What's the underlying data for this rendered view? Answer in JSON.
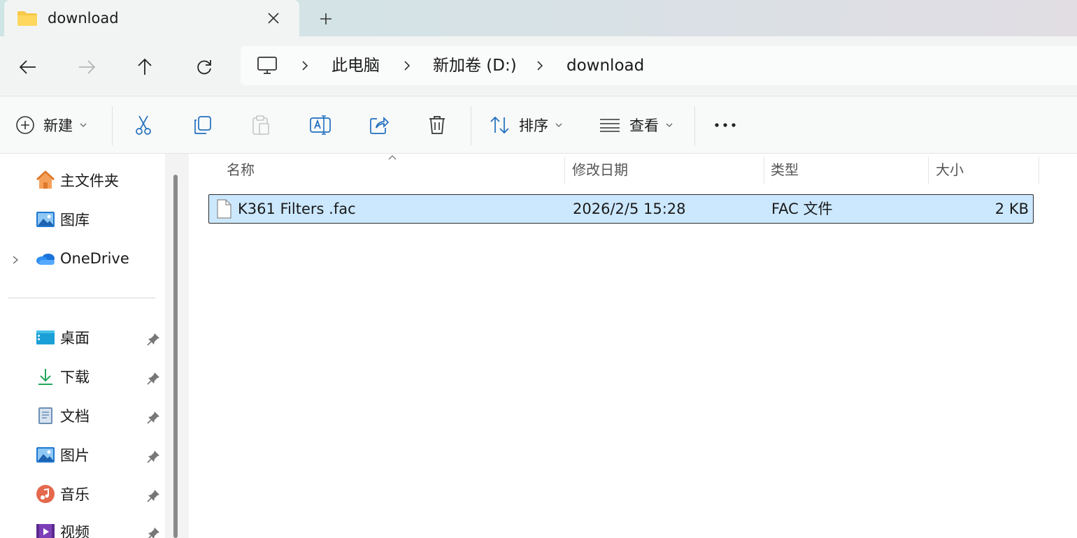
{
  "tab": {
    "title": "download",
    "new_tab_symbol": "+"
  },
  "nav": {
    "breadcrumbs": [
      "此电脑",
      "新加卷 (D:)",
      "download"
    ]
  },
  "toolbar": {
    "new_label": "新建",
    "sort_label": "排序",
    "view_label": "查看"
  },
  "sidebar": {
    "top_items": [
      {
        "label": "主文件夹",
        "icon": "home-icon"
      },
      {
        "label": "图库",
        "icon": "gallery-icon"
      },
      {
        "label": "OneDrive",
        "icon": "onedrive-cloud-icon"
      }
    ],
    "pinned_items": [
      {
        "label": "桌面",
        "icon": "desktop-icon"
      },
      {
        "label": "下载",
        "icon": "download-icon"
      },
      {
        "label": "文档",
        "icon": "document-icon"
      },
      {
        "label": "图片",
        "icon": "pictures-icon"
      },
      {
        "label": "音乐",
        "icon": "music-icon"
      },
      {
        "label": "视频",
        "icon": "video-icon"
      }
    ]
  },
  "columns": {
    "name": "名称",
    "modified": "修改日期",
    "type": "类型",
    "size": "大小"
  },
  "files": [
    {
      "name": "K361 Filters .fac",
      "modified": "2026/2/5 15:28",
      "type": "FAC 文件",
      "size": "2 KB",
      "selected": true
    }
  ],
  "colors": {
    "selection_bg": "#cce8ff",
    "accent": "#0067c0"
  }
}
